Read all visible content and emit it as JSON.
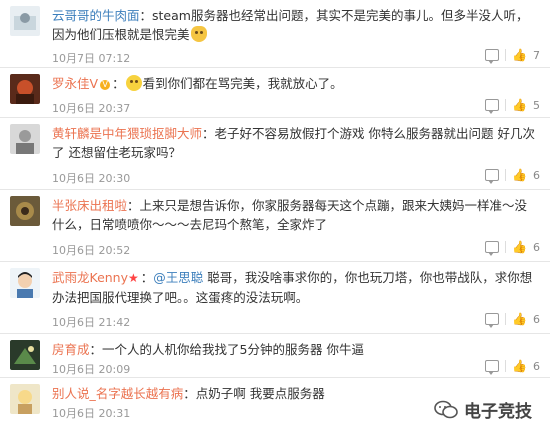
{
  "comments": [
    {
      "user": "云哥哥的牛肉面",
      "text_before": "：steam服务器也经常出问题，其实不是完美的事儿。但多半没人听，因为他们压根就是恨完美",
      "time": "10月7日 07:12",
      "likes": "7"
    },
    {
      "user": "罗永佳V",
      "text_after": "看到你们都在骂完美，我就放心了。",
      "time": "10月6日 20:37",
      "likes": "5"
    },
    {
      "user": "黄轩麟是中年猥琐抠脚大师",
      "text": "：老子好不容易放假打个游戏 你特么服务器就出问题 好几次了 还想留住老玩家吗？",
      "time": "10月6日 20:30",
      "likes": "6"
    },
    {
      "user": "半张床出租啦",
      "text": "：上来只是想告诉你，你家服务器每天这个点蹦，跟来大姨妈一样准～没什么，日常喷喷你～～～去尼玛个熬笔，全家炸了",
      "time": "10月6日 20:52",
      "likes": "6"
    },
    {
      "user": "武雨龙Kenny",
      "mention": "@王思聪",
      "text": "聪哥，我没啥事求你的，你也玩刀塔，你也带战队，求你想办法把国服代理换了吧。。这蛋疼的没法玩啊。",
      "time": "10月6日 21:42",
      "likes": "6"
    },
    {
      "user": "房育成",
      "text": "：一个人的人机你给我找了5分钟的服务器 你牛逼",
      "time": "10月6日 20:09",
      "likes": "6"
    },
    {
      "user": "别人说_名字越长越有病",
      "text": "：点奶子啊 我要点服务器",
      "time": "10月6日 20:31",
      "likes": ""
    }
  ],
  "watermark": "电子竞技",
  "colors": {
    "username": "#eb7350",
    "link": "#3d7fbc",
    "meta": "#999999"
  }
}
